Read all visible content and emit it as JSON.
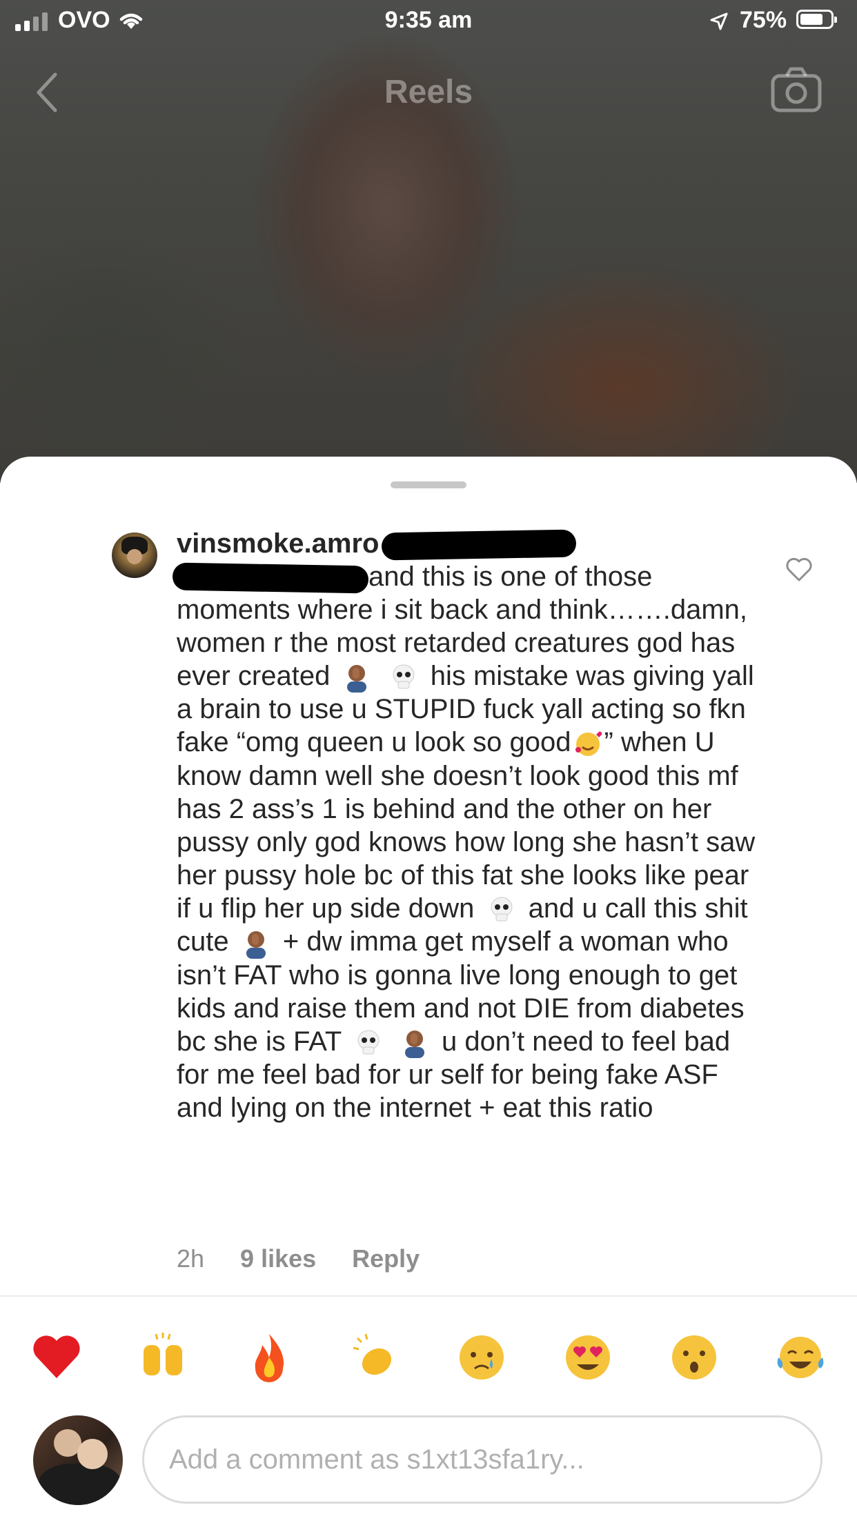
{
  "status_bar": {
    "carrier": "OVO",
    "time": "9:35 am",
    "battery_percent_text": "75%",
    "battery_level": 0.75
  },
  "nav": {
    "title": "Reels",
    "back_icon": "chevron-left-icon",
    "camera_icon": "camera-icon"
  },
  "comment": {
    "username": "vinsmoke.amro",
    "lines": [
      "and this is one of those moments where i sit back and think…….damn, women r the most retarded creatures god has ever created",
      "his mistake was giving yall a brain to use u STUPID fuck yall acting so fkn fake “omg queen u look so good",
      "” when U know damn well she doesn’t look good this mf has 2 ass’s 1 is behind and the other on her pussy only god knows how long she hasn’t saw her pussy hole bc of this fat she looks like pear if u flip her up side down",
      "and u call this shit cute",
      "+ dw imma get myself a woman who isn’t FAT who is gonna live long enough to get kids and raise them and not DIE from diabetes bc she is FAT",
      "u don’t need to feel bad for me feel bad for ur self for being fake ASF and lying on the internet + eat this ratio"
    ],
    "time_ago": "2h",
    "likes": "9 likes",
    "reply": "Reply"
  },
  "reactions": [
    "heart",
    "raised-hands",
    "fire",
    "clapping",
    "crying",
    "heart-eyes",
    "surprised",
    "tears-of-joy"
  ],
  "composer": {
    "placeholder": "Add a comment as s1xt13sfa1ry..."
  },
  "colors": {
    "text": "#262626",
    "muted": "#8e8e8e",
    "sheet": "#ffffff"
  }
}
